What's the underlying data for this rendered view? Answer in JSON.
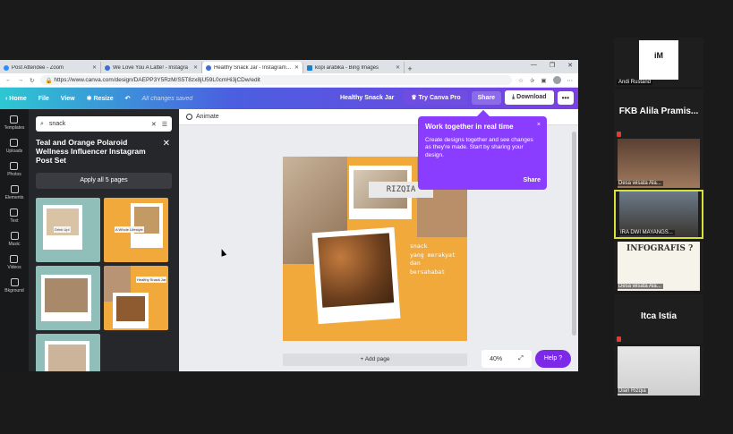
{
  "browser": {
    "tabs": [
      {
        "label": "Post Attendee - Zoom",
        "icon": "zoom-icon"
      },
      {
        "label": "We Love You A Latte! - Instagra",
        "icon": "canva-icon"
      },
      {
        "label": "Healthy Snack Jar - Instagram Po",
        "icon": "canva-icon"
      },
      {
        "label": "kopi arabika - Bing Images",
        "icon": "bing-icon"
      }
    ],
    "new_tab": "+",
    "url": "https://www.canva.com/design/DAEPP3Y5RzM/S5T8zx8jU59L0cmHi3jCDw/edit",
    "window_controls": [
      "—",
      "❐",
      "✕"
    ]
  },
  "canva": {
    "topbar": {
      "home": "Home",
      "file": "File",
      "view": "View",
      "resize": "Resize",
      "saved": "All changes saved",
      "doc_name": "Healthy Snack Jar",
      "try_pro": "Try Canva Pro",
      "share": "Share",
      "download": "Download",
      "more": "•••"
    },
    "rail": [
      {
        "label": "Templates",
        "icon": "templates-icon"
      },
      {
        "label": "Uploads",
        "icon": "uploads-icon"
      },
      {
        "label": "Photos",
        "icon": "photos-icon"
      },
      {
        "label": "Elements",
        "icon": "elements-icon"
      },
      {
        "label": "Text",
        "icon": "text-icon"
      },
      {
        "label": "Music",
        "icon": "music-icon"
      },
      {
        "label": "Videos",
        "icon": "videos-icon"
      },
      {
        "label": "Bkground",
        "icon": "background-icon"
      }
    ],
    "panel": {
      "search_value": "snack",
      "title": "Teal and Orange Polaroid Wellness Influencer Instagram Post Set",
      "apply_all": "Apply all 5 pages",
      "thumb_captions": [
        "Drink Up!",
        "A Whole Lifestyle",
        "",
        "Healthy Snack Jar"
      ]
    },
    "toolbar": {
      "animate": "Animate"
    },
    "design": {
      "name": "RIZQIA",
      "tagline": "snack\nyang merakyat\ndan\nbersahabat"
    },
    "add_page": "+ Add page",
    "zoom": "40%",
    "help": "Help ?",
    "popover": {
      "title": "Work together in real time",
      "body": "Create designs together and see changes as they're made. Start by sharing your design.",
      "share": "Share",
      "close": "×"
    }
  },
  "participants": [
    {
      "name": "Andi Rustand",
      "type": "logo",
      "logo": "iM"
    },
    {
      "name": "FKB Alila Pramis...",
      "type": "name"
    },
    {
      "name": "Desa wisata Ala...",
      "type": "video"
    },
    {
      "name": "IRA DWI MAYANGS...",
      "type": "video",
      "highlighted": true
    },
    {
      "name": "Desa wisata Ala...",
      "type": "video",
      "caption": "INFOGRAFIS ?"
    },
    {
      "name": "Itca Istia",
      "type": "name"
    },
    {
      "name": "Dian Rizqia",
      "type": "video"
    }
  ]
}
